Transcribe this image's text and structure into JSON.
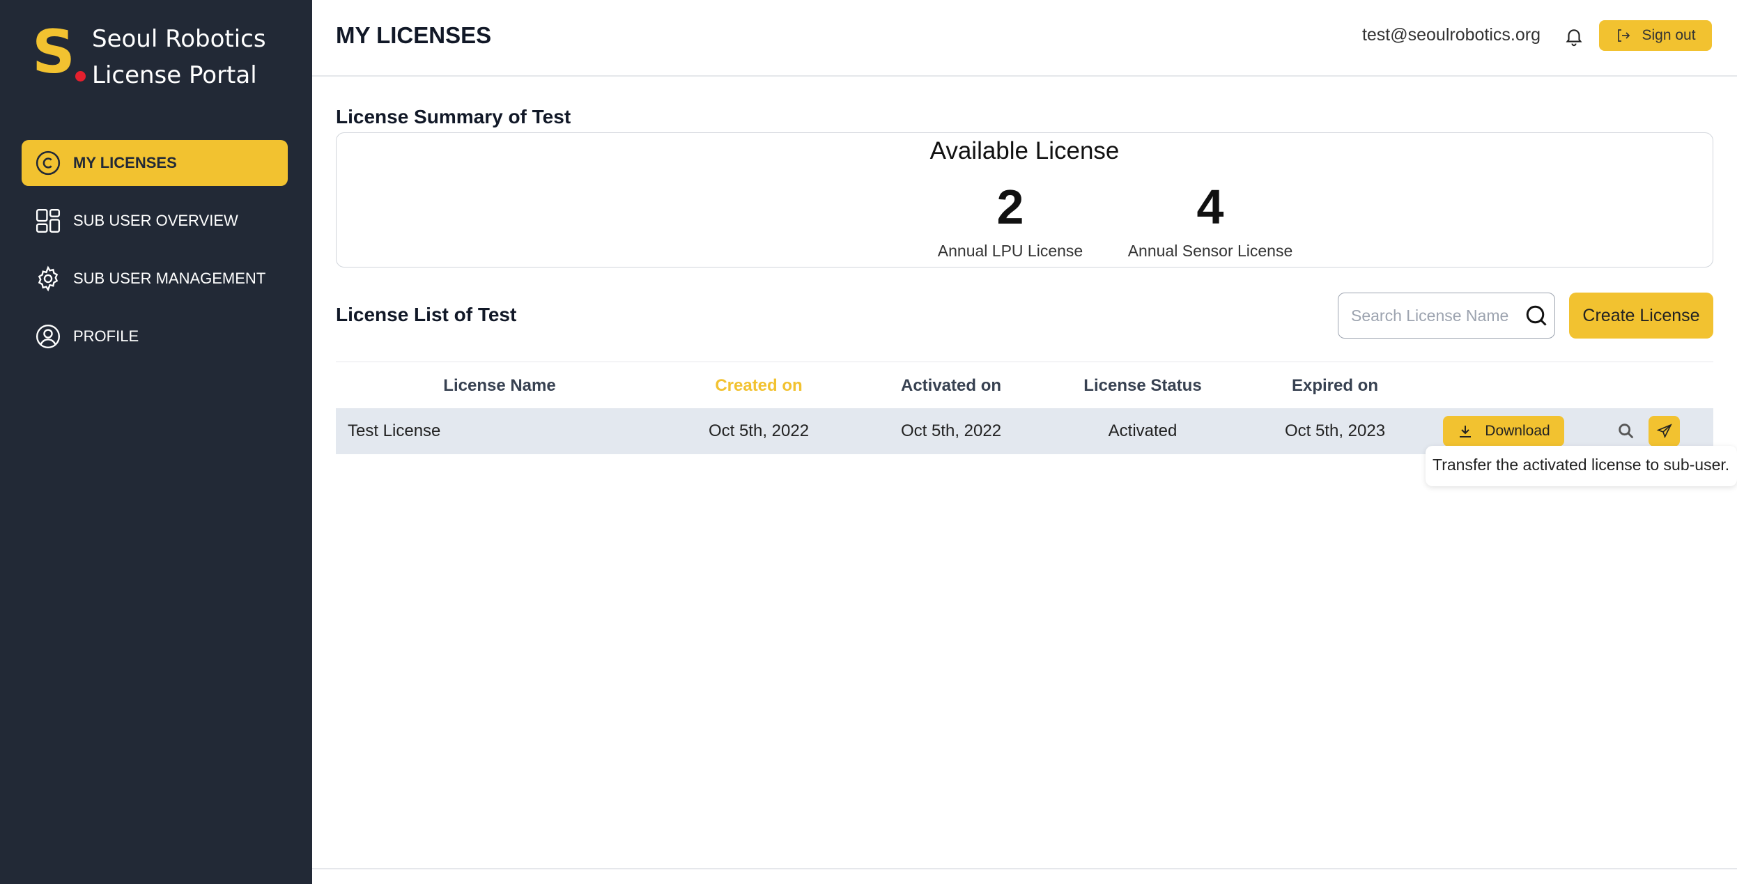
{
  "brand": {
    "logo_letter": "S",
    "line1": "Seoul Robotics",
    "line2": "License Portal",
    "accent": "#f2c230",
    "dot_color": "#e4202e"
  },
  "sidebar": {
    "background": "#222936",
    "items": [
      {
        "label": "MY LICENSES",
        "icon": "copyright-icon",
        "active": true
      },
      {
        "label": "SUB USER OVERVIEW",
        "icon": "grid-icon",
        "active": false
      },
      {
        "label": "SUB USER MANAGEMENT",
        "icon": "gear-icon",
        "active": false
      },
      {
        "label": "PROFILE",
        "icon": "user-circle-icon",
        "active": false
      }
    ]
  },
  "header": {
    "title": "MY LICENSES",
    "email": "test@seoulrobotics.org",
    "sign_out": "Sign out"
  },
  "summary": {
    "title": "License Summary of Test",
    "heading": "Available License",
    "stats": [
      {
        "value": "2",
        "label": "Annual LPU License"
      },
      {
        "value": "4",
        "label": "Annual Sensor License"
      }
    ]
  },
  "list": {
    "title": "License List of Test",
    "search_placeholder": "Search License Name",
    "create_label": "Create License",
    "columns": [
      "License Name",
      "Created on",
      "Activated on",
      "License Status",
      "Expired on"
    ],
    "sorted_column": "Created on",
    "rows": [
      {
        "name": "Test License",
        "created": "Oct 5th, 2022",
        "activated": "Oct 5th, 2022",
        "status": "Activated",
        "expired": "Oct 5th, 2023",
        "download_label": "Download"
      }
    ],
    "tooltip": "Transfer the activated license to sub-user."
  }
}
